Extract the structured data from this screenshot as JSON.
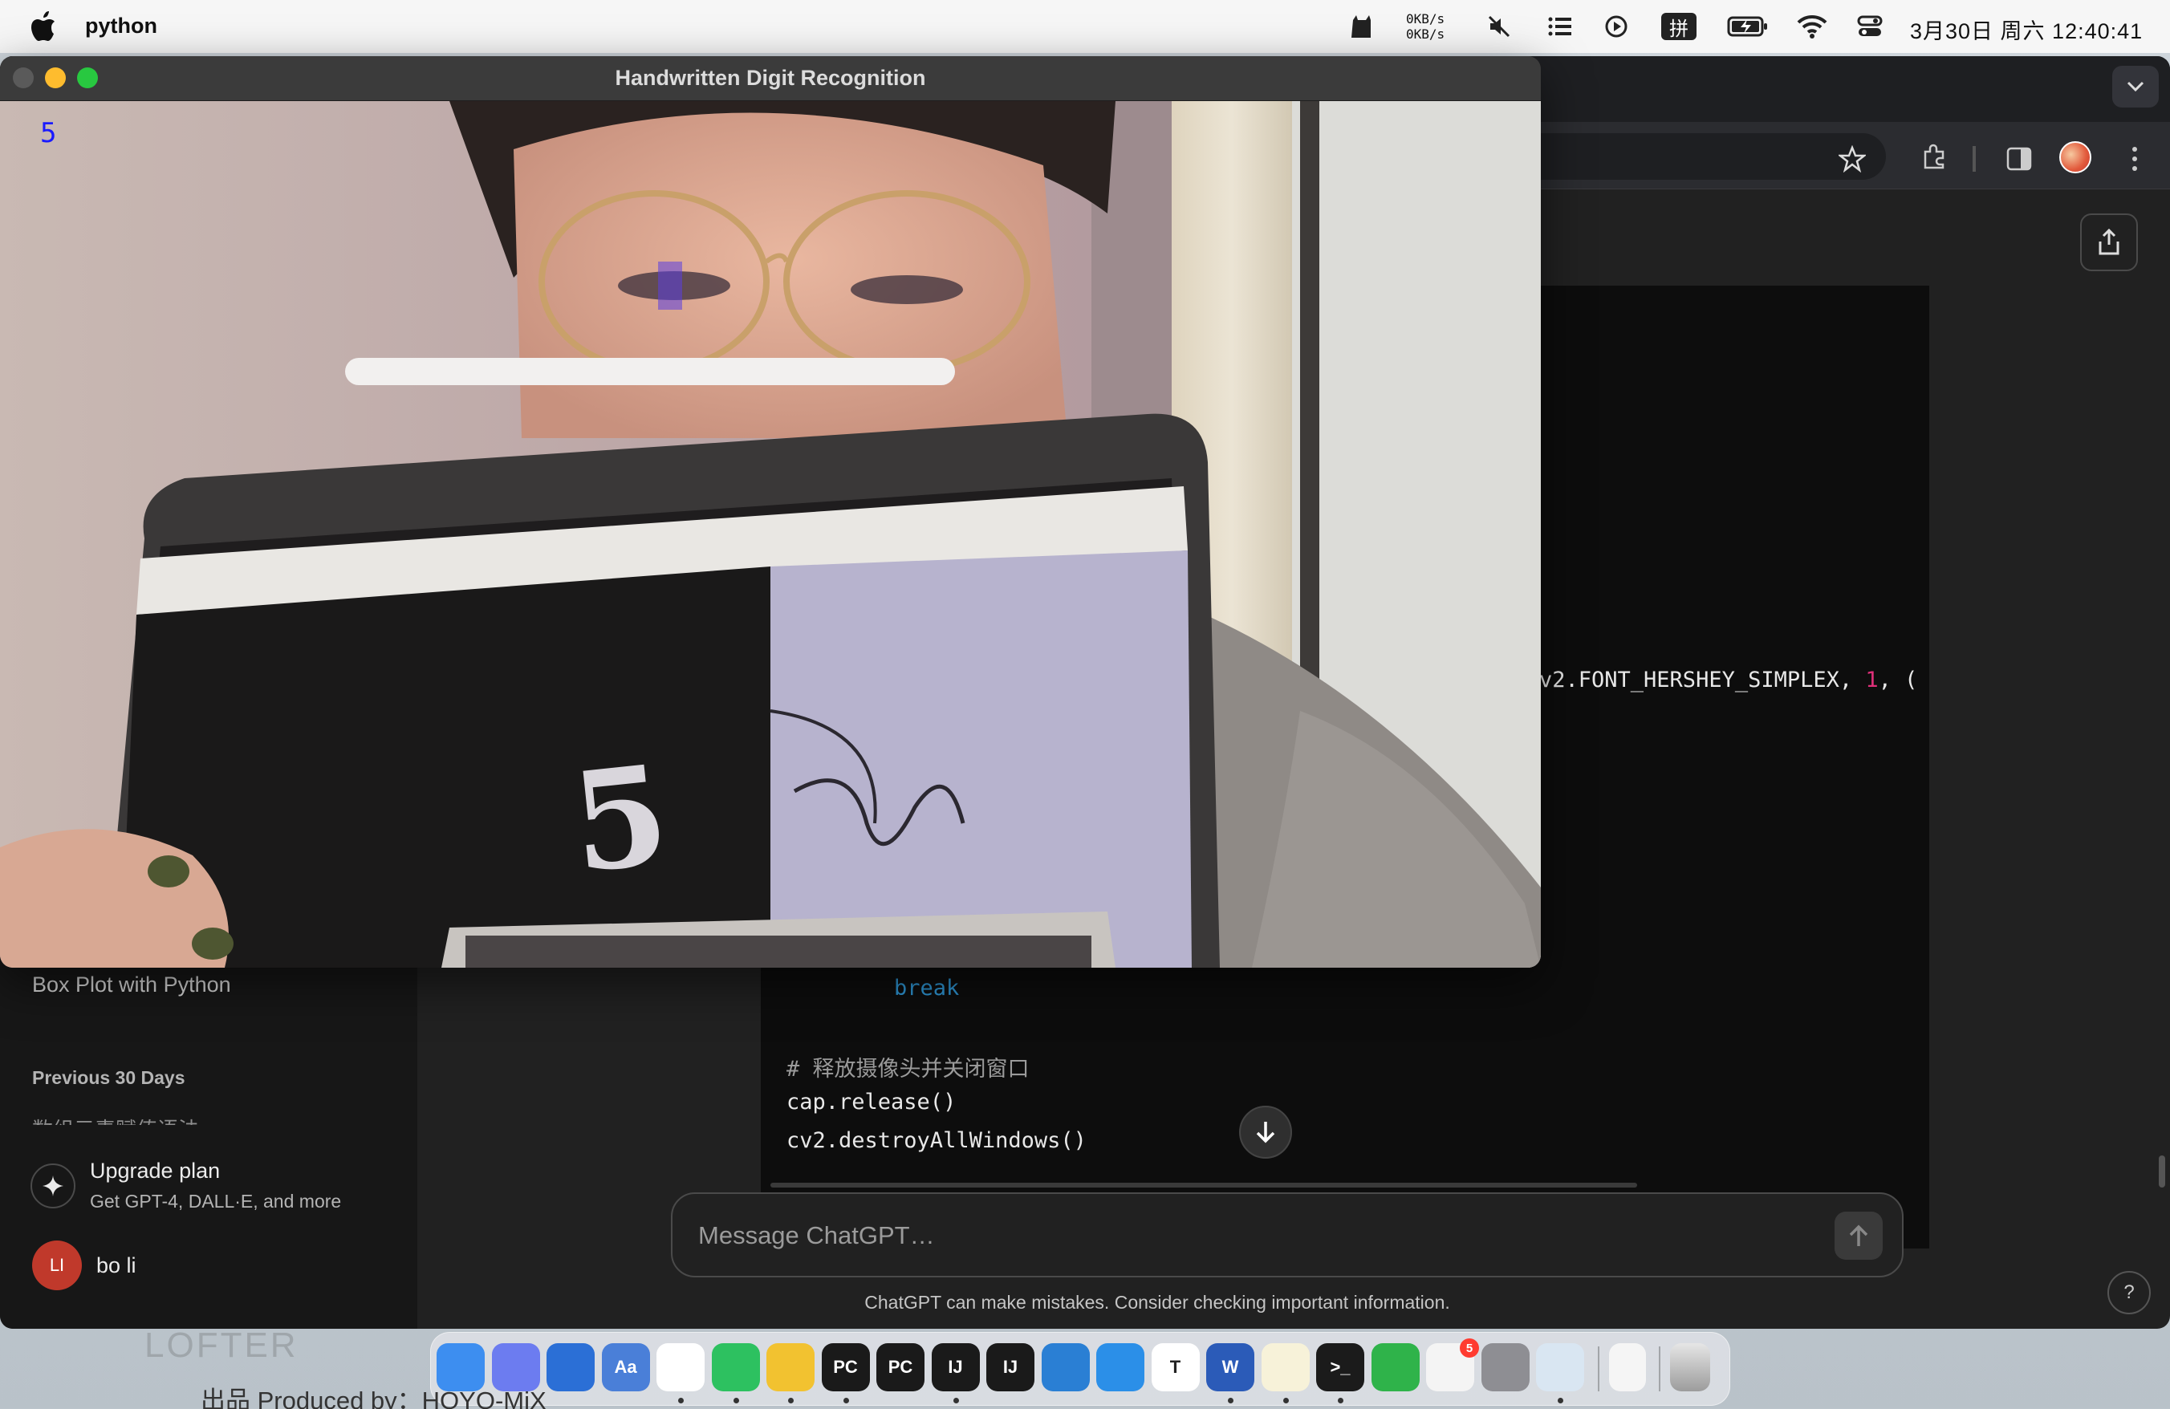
{
  "menubar": {
    "app_name": "python",
    "net_up": "0KB/s",
    "net_down": "0KB/s",
    "input_method": "拼",
    "clock": "3月30日 周六  12:40:41"
  },
  "opencv_window": {
    "title": "Handwritten Digit Recognition",
    "predicted_digit": "5"
  },
  "chatgpt": {
    "sidebar": {
      "chat_item": "Box Plot with Python",
      "section_label": "Previous 30 Days",
      "faded_item": "数组元素赋值语法",
      "upgrade_title": "Upgrade plan",
      "upgrade_subtitle": "Get GPT-4, DALL·E, and more",
      "user_initials": "LI",
      "user_name": "bo li"
    },
    "code": {
      "line_puttext_a": "v2.FONT_HERSHEY_SIMPLEX, ",
      "line_puttext_num": "1",
      "line_puttext_b": ", (",
      "line_break": "break",
      "line_comment": "# 释放摄像头并关闭窗口",
      "line_release": "cap.release()",
      "line_destroy": "cv2.destroyAllWindows()"
    },
    "composer_placeholder": "Message ChatGPT…",
    "disclaimer": "ChatGPT can make mistakes. Consider checking important information.",
    "help_label": "?"
  },
  "dock": {
    "apps": [
      {
        "name": "Finder",
        "label": "",
        "color": "#3d8ef0"
      },
      {
        "name": "Launchpad",
        "label": "",
        "color": "#6c7cf0"
      },
      {
        "name": "Sourcetree",
        "label": "",
        "color": "#2b6fd6"
      },
      {
        "name": "Dictionary",
        "label": "Aa",
        "color": "#4a7fd8"
      },
      {
        "name": "Chrome",
        "label": "",
        "color": "#ffffff"
      },
      {
        "name": "WeChat",
        "label": "",
        "color": "#2dc160"
      },
      {
        "name": "Maps",
        "label": "",
        "color": "#f2c230"
      },
      {
        "name": "PyCharm",
        "label": "PC",
        "color": "#1a1a1a"
      },
      {
        "name": "PyCharm CE",
        "label": "PC",
        "color": "#1a1a1a"
      },
      {
        "name": "IntelliJ IDEA",
        "label": "IJ",
        "color": "#1a1a1a"
      },
      {
        "name": "IntelliJ IDEA CE",
        "label": "IJ",
        "color": "#1a1a1a"
      },
      {
        "name": "VS Code",
        "label": "",
        "color": "#2a7fd4"
      },
      {
        "name": "Docker",
        "label": "",
        "color": "#2b8fe8"
      },
      {
        "name": "Typora",
        "label": "T",
        "color": "#ffffff"
      },
      {
        "name": "Word",
        "label": "W",
        "color": "#2b5bb8"
      },
      {
        "name": "Notes",
        "label": "",
        "color": "#f7f2d9"
      },
      {
        "name": "Terminal",
        "label": ">_",
        "color": "#1b1b1b"
      },
      {
        "name": "Numbers",
        "label": "",
        "color": "#2fb34a"
      },
      {
        "name": "Reminders",
        "label": "",
        "color": "#f4f4f4"
      },
      {
        "name": "System Settings",
        "label": "",
        "color": "#8e8e93"
      },
      {
        "name": "Preview",
        "label": "",
        "color": "#d9e6f2"
      }
    ],
    "reminders_badge": "5"
  },
  "credit": {
    "text": "出品 Produced by：HOYO-MiX",
    "faded": "LOFTER"
  }
}
